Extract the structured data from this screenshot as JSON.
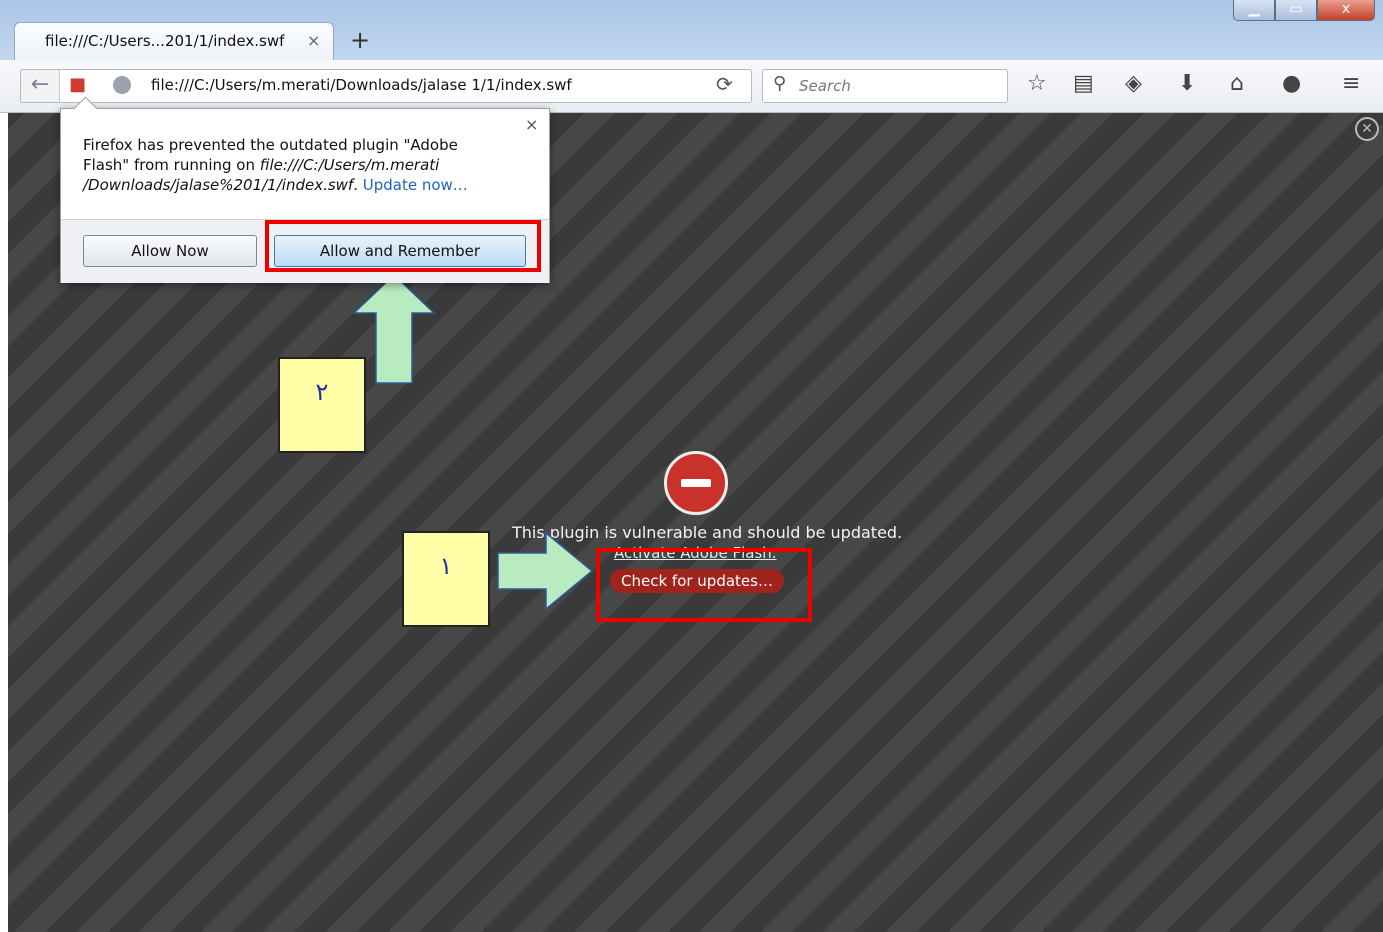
{
  "tab": {
    "title": "file:///C:/Users...201/1/index.swf",
    "close": "×",
    "new_tab": "+"
  },
  "window_controls": {
    "minimize": "▁",
    "maximize": "▭",
    "close": "x"
  },
  "nav": {
    "back": "←",
    "url": "file:///C:/Users/m.merati/Downloads/jalase 1/1/index.swf",
    "reload": "⟳",
    "search_placeholder": "Search"
  },
  "toolbar_icons": [
    "star-icon",
    "reading-list-icon",
    "pocket-icon",
    "download-icon",
    "home-icon",
    "chat-icon",
    "menu-icon"
  ],
  "popup": {
    "close": "×",
    "line1": "Firefox has prevented the outdated plugin \"Adobe",
    "line2_prefix": "Flash\" from running on ",
    "line2_italic": "file:///C:/Users/m.merati",
    "line3_italic": "/Downloads/jalase%201/1/index.swf",
    "line3_suffix": ". ",
    "update_link": "Update now…",
    "allow_now": "Allow Now",
    "allow_remember": "Allow and Remember"
  },
  "plugin": {
    "message": "This plugin is vulnerable and should be updated.",
    "activate": "Activate Adobe Flash.",
    "check_updates": "Check for updates…"
  },
  "annotations": {
    "step1": "١",
    "step2": "٢"
  },
  "colors": {
    "stripe_dark": "#3a3a3a",
    "stripe_light": "#474747",
    "highlight": "#e00000",
    "note_bg": "#ffffa8",
    "arrow": "#b8ecc0"
  }
}
